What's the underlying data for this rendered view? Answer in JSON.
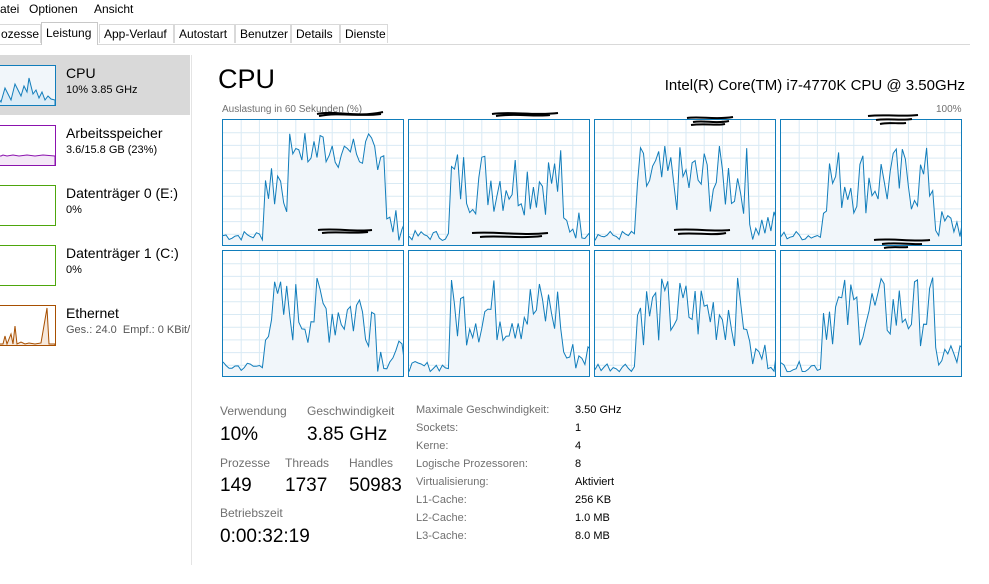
{
  "menu": [
    "atei",
    "Optionen",
    "Ansicht"
  ],
  "tabs": [
    "ozesse",
    "Leistung",
    "App-Verlauf",
    "Autostart",
    "Benutzer",
    "Details",
    "Dienste"
  ],
  "active_tab": "Leistung",
  "sidebar": {
    "items": [
      {
        "title": "CPU",
        "sub": "10%  3.85 GHz",
        "color": "#117dbb"
      },
      {
        "title": "Arbeitsspeicher",
        "sub": "3.6/15.8 GB (23%)",
        "color": "#8b12ae"
      },
      {
        "title": "Datenträger 0 (E:)",
        "sub": "0%",
        "color": "#4da60c"
      },
      {
        "title": "Datenträger 1 (C:)",
        "sub": "0%",
        "color": "#4da60c"
      },
      {
        "title": "Ethernet",
        "sub_a": "Ges.: 24.0",
        "sub_b": "Empf.: 0 KBit/",
        "color": "#a74f01"
      }
    ]
  },
  "main": {
    "title": "CPU",
    "cpu_model": "Intel(R) Core(TM) i7-4770K CPU @ 3.50GHz",
    "graph_label": "Auslastung in 60 Sekunden (%)",
    "graph_max": "100%"
  },
  "stats": {
    "usage_label": "Verwendung",
    "usage": "10%",
    "speed_label": "Geschwindigkeit",
    "speed": "3.85 GHz",
    "processes_label": "Prozesse",
    "processes": "149",
    "threads_label": "Threads",
    "threads": "1737",
    "handles_label": "Handles",
    "handles": "50983",
    "uptime_label": "Betriebszeit",
    "uptime": "0:00:32:19"
  },
  "details": [
    {
      "k": "Maximale Geschwindigkeit:",
      "v": "3.50 GHz"
    },
    {
      "k": "Sockets:",
      "v": "1"
    },
    {
      "k": "Kerne:",
      "v": "4"
    },
    {
      "k": "Logische Prozessoren:",
      "v": "8"
    },
    {
      "k": "Virtualisierung:",
      "v": "Aktiviert"
    },
    {
      "k": "L1-Cache:",
      "v": "256 KB"
    },
    {
      "k": "L2-Cache:",
      "v": "1.0 MB"
    },
    {
      "k": "L3-Cache:",
      "v": "8.0 MB"
    }
  ],
  "colors": {
    "cpu": "#117dbb",
    "fill": "#f1f6fa",
    "grid": "#d9eaf4"
  }
}
